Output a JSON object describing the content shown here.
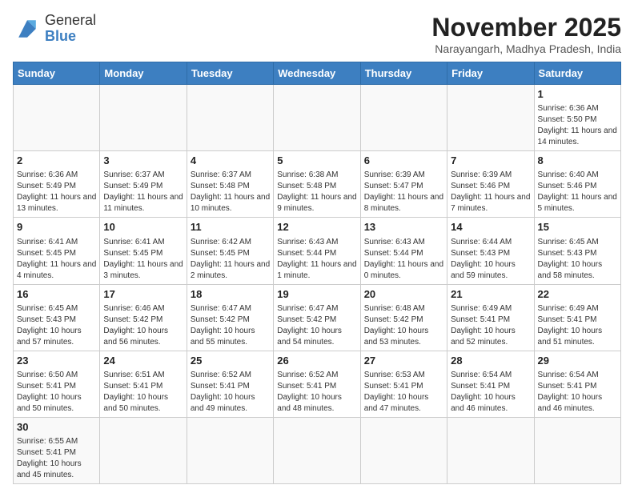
{
  "header": {
    "logo_line1": "General",
    "logo_line2": "Blue",
    "title": "November 2025",
    "subtitle": "Narayangarh, Madhya Pradesh, India"
  },
  "weekdays": [
    "Sunday",
    "Monday",
    "Tuesday",
    "Wednesday",
    "Thursday",
    "Friday",
    "Saturday"
  ],
  "weeks": [
    [
      {
        "day": "",
        "info": ""
      },
      {
        "day": "",
        "info": ""
      },
      {
        "day": "",
        "info": ""
      },
      {
        "day": "",
        "info": ""
      },
      {
        "day": "",
        "info": ""
      },
      {
        "day": "",
        "info": ""
      },
      {
        "day": "1",
        "info": "Sunrise: 6:36 AM\nSunset: 5:50 PM\nDaylight: 11 hours and 14 minutes."
      }
    ],
    [
      {
        "day": "2",
        "info": "Sunrise: 6:36 AM\nSunset: 5:49 PM\nDaylight: 11 hours and 13 minutes."
      },
      {
        "day": "3",
        "info": "Sunrise: 6:37 AM\nSunset: 5:49 PM\nDaylight: 11 hours and 11 minutes."
      },
      {
        "day": "4",
        "info": "Sunrise: 6:37 AM\nSunset: 5:48 PM\nDaylight: 11 hours and 10 minutes."
      },
      {
        "day": "5",
        "info": "Sunrise: 6:38 AM\nSunset: 5:48 PM\nDaylight: 11 hours and 9 minutes."
      },
      {
        "day": "6",
        "info": "Sunrise: 6:39 AM\nSunset: 5:47 PM\nDaylight: 11 hours and 8 minutes."
      },
      {
        "day": "7",
        "info": "Sunrise: 6:39 AM\nSunset: 5:46 PM\nDaylight: 11 hours and 7 minutes."
      },
      {
        "day": "8",
        "info": "Sunrise: 6:40 AM\nSunset: 5:46 PM\nDaylight: 11 hours and 5 minutes."
      }
    ],
    [
      {
        "day": "9",
        "info": "Sunrise: 6:41 AM\nSunset: 5:45 PM\nDaylight: 11 hours and 4 minutes."
      },
      {
        "day": "10",
        "info": "Sunrise: 6:41 AM\nSunset: 5:45 PM\nDaylight: 11 hours and 3 minutes."
      },
      {
        "day": "11",
        "info": "Sunrise: 6:42 AM\nSunset: 5:45 PM\nDaylight: 11 hours and 2 minutes."
      },
      {
        "day": "12",
        "info": "Sunrise: 6:43 AM\nSunset: 5:44 PM\nDaylight: 11 hours and 1 minute."
      },
      {
        "day": "13",
        "info": "Sunrise: 6:43 AM\nSunset: 5:44 PM\nDaylight: 11 hours and 0 minutes."
      },
      {
        "day": "14",
        "info": "Sunrise: 6:44 AM\nSunset: 5:43 PM\nDaylight: 10 hours and 59 minutes."
      },
      {
        "day": "15",
        "info": "Sunrise: 6:45 AM\nSunset: 5:43 PM\nDaylight: 10 hours and 58 minutes."
      }
    ],
    [
      {
        "day": "16",
        "info": "Sunrise: 6:45 AM\nSunset: 5:43 PM\nDaylight: 10 hours and 57 minutes."
      },
      {
        "day": "17",
        "info": "Sunrise: 6:46 AM\nSunset: 5:42 PM\nDaylight: 10 hours and 56 minutes."
      },
      {
        "day": "18",
        "info": "Sunrise: 6:47 AM\nSunset: 5:42 PM\nDaylight: 10 hours and 55 minutes."
      },
      {
        "day": "19",
        "info": "Sunrise: 6:47 AM\nSunset: 5:42 PM\nDaylight: 10 hours and 54 minutes."
      },
      {
        "day": "20",
        "info": "Sunrise: 6:48 AM\nSunset: 5:42 PM\nDaylight: 10 hours and 53 minutes."
      },
      {
        "day": "21",
        "info": "Sunrise: 6:49 AM\nSunset: 5:41 PM\nDaylight: 10 hours and 52 minutes."
      },
      {
        "day": "22",
        "info": "Sunrise: 6:49 AM\nSunset: 5:41 PM\nDaylight: 10 hours and 51 minutes."
      }
    ],
    [
      {
        "day": "23",
        "info": "Sunrise: 6:50 AM\nSunset: 5:41 PM\nDaylight: 10 hours and 50 minutes."
      },
      {
        "day": "24",
        "info": "Sunrise: 6:51 AM\nSunset: 5:41 PM\nDaylight: 10 hours and 50 minutes."
      },
      {
        "day": "25",
        "info": "Sunrise: 6:52 AM\nSunset: 5:41 PM\nDaylight: 10 hours and 49 minutes."
      },
      {
        "day": "26",
        "info": "Sunrise: 6:52 AM\nSunset: 5:41 PM\nDaylight: 10 hours and 48 minutes."
      },
      {
        "day": "27",
        "info": "Sunrise: 6:53 AM\nSunset: 5:41 PM\nDaylight: 10 hours and 47 minutes."
      },
      {
        "day": "28",
        "info": "Sunrise: 6:54 AM\nSunset: 5:41 PM\nDaylight: 10 hours and 46 minutes."
      },
      {
        "day": "29",
        "info": "Sunrise: 6:54 AM\nSunset: 5:41 PM\nDaylight: 10 hours and 46 minutes."
      }
    ],
    [
      {
        "day": "30",
        "info": "Sunrise: 6:55 AM\nSunset: 5:41 PM\nDaylight: 10 hours and 45 minutes."
      },
      {
        "day": "",
        "info": ""
      },
      {
        "day": "",
        "info": ""
      },
      {
        "day": "",
        "info": ""
      },
      {
        "day": "",
        "info": ""
      },
      {
        "day": "",
        "info": ""
      },
      {
        "day": "",
        "info": ""
      }
    ]
  ]
}
